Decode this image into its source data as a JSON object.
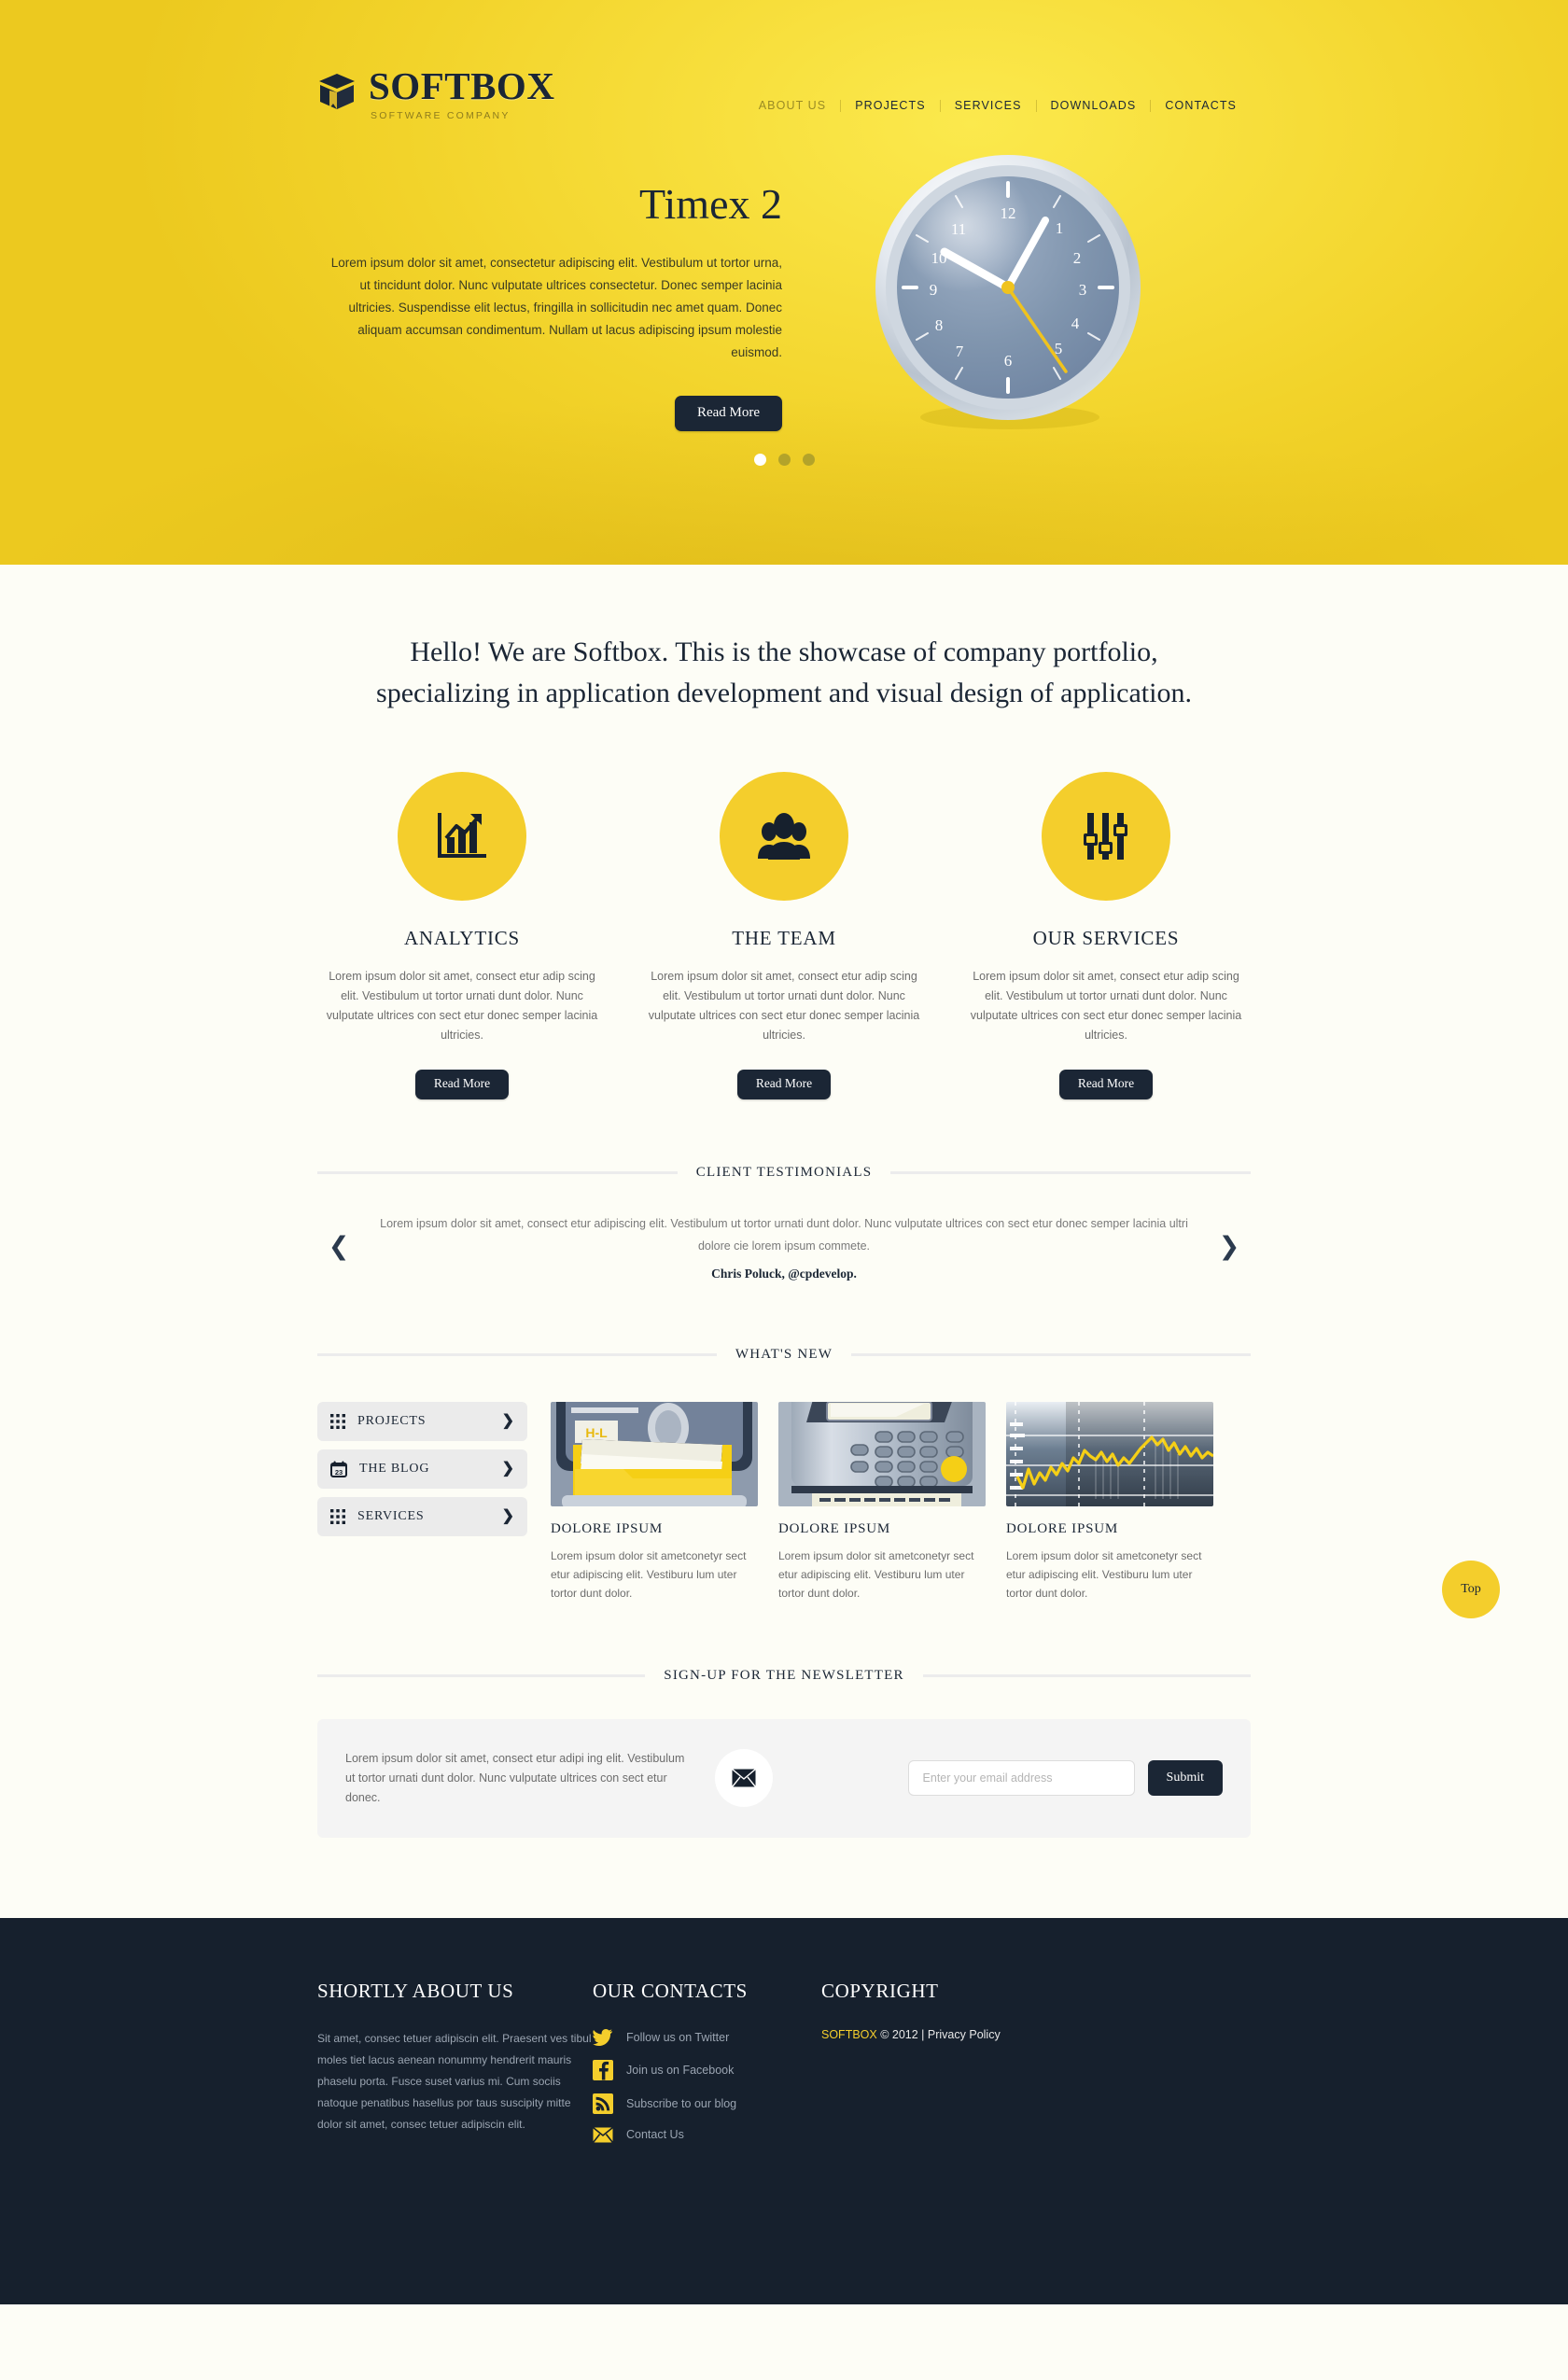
{
  "brand": {
    "name": "SOFTBOX",
    "tagline": "SOFTWARE COMPANY",
    "logo_icon": "open-box-icon",
    "accent_color": "#f4ce2c",
    "dark_color": "#1b2635"
  },
  "nav": {
    "items": [
      {
        "label": "ABOUT US",
        "muted": true
      },
      {
        "label": "PROJECTS",
        "muted": false
      },
      {
        "label": "SERVICES",
        "muted": false
      },
      {
        "label": "DOWNLOADS",
        "muted": false
      },
      {
        "label": "CONTACTS",
        "muted": false
      }
    ]
  },
  "hero": {
    "title": "Timex 2",
    "text": "Lorem ipsum dolor sit amet, consectetur adipiscing elit. Vestibulum ut tortor urna, ut tincidunt dolor. Nunc vulputate ultrices consectetur. Donec semper lacinia ultricies. Suspendisse elit lectus, fringilla in sollicitudin nec amet quam. Donec aliquam accumsan condimentum. Nullam ut lacus adipiscing ipsum molestie euismod.",
    "button_label": "Read More",
    "image_icon": "wall-clock-image",
    "slides": [
      {
        "active": true
      },
      {
        "active": false
      },
      {
        "active": false
      }
    ]
  },
  "intro": {
    "headline": "Hello! We are Softbox. This is the showcase of company portfolio, specializing in application development and visual design of application."
  },
  "features": [
    {
      "icon": "chart-growth-icon",
      "title": "ANALYTICS",
      "text": "Lorem ipsum dolor sit amet, consect etur adip scing elit. Vestibulum ut tortor urnati dunt dolor. Nunc vulputate ultrices con sect etur donec semper lacinia ultricies.",
      "button_label": "Read More"
    },
    {
      "icon": "people-group-icon",
      "title": "THE TEAM",
      "text": "Lorem ipsum dolor sit amet, consect etur adip scing elit. Vestibulum ut tortor urnati dunt dolor. Nunc vulputate ultrices con sect etur donec semper lacinia ultricies.",
      "button_label": "Read More"
    },
    {
      "icon": "sliders-equalizer-icon",
      "title": "OUR SERVICES",
      "text": "Lorem ipsum dolor sit amet, consect etur adip scing elit. Vestibulum ut tortor urnati dunt dolor. Nunc vulputate ultrices con sect etur donec semper lacinia ultricies.",
      "button_label": "Read More"
    }
  ],
  "testimonials": {
    "section_title": "CLIENT TESTIMONIALS",
    "prev_icon": "chevron-left-icon",
    "next_icon": "chevron-right-icon",
    "quote": "Lorem ipsum dolor sit amet, consect etur adipiscing elit. Vestibulum ut tortor urnati dunt dolor. Nunc vulputate ultrices con sect etur donec semper lacinia ultri  dolore cie lorem ipsum commete.",
    "author": "Chris Poluck, @cpdevelop."
  },
  "whats_new": {
    "section_title": "WHAT'S NEW",
    "tabs": [
      {
        "label": "PROJECTS",
        "icon": "grid-icon",
        "chevron": "chevron-right-icon"
      },
      {
        "label": "THE BLOG",
        "icon": "calendar-icon",
        "calendar_day": "23",
        "chevron": "chevron-right-icon"
      },
      {
        "label": "SERVICES",
        "icon": "grid-icon",
        "chevron": "chevron-right-icon"
      }
    ],
    "cards": [
      {
        "image_icon": "filing-cabinet-image",
        "folder_label": "H-L",
        "title": "DOLORE IPSUM",
        "text": "Lorem ipsum dolor sit ametconetyr sect etur adipiscing elit. Vestiburu lum uter tortor dunt dolor."
      },
      {
        "image_icon": "calculator-device-image",
        "title": "DOLORE IPSUM",
        "text": "Lorem ipsum dolor sit ametconetyr sect etur adipiscing elit. Vestiburu lum uter tortor dunt dolor."
      },
      {
        "image_icon": "stock-chart-image",
        "title": "DOLORE IPSUM",
        "text": "Lorem ipsum dolor sit ametconetyr sect etur adipiscing elit. Vestiburu lum uter tortor dunt dolor."
      }
    ]
  },
  "newsletter": {
    "section_title": "SIGN-UP FOR THE NEWSLETTER",
    "text": "Lorem ipsum dolor sit amet, consect etur adipi ing elit. Vestibulum ut tortor urnati dunt dolor. Nunc vulputate ultrices con sect etur donec.",
    "icon": "envelope-icon",
    "input_placeholder": "Enter your email address",
    "input_value": "",
    "submit_label": "Submit"
  },
  "top_button": {
    "label": "Top"
  },
  "footer": {
    "about": {
      "title": "SHORTLY ABOUT US",
      "text": "Sit amet, consec tetuer adipiscin elit. Praesent ves tibul moles tiet lacus aenean nonummy hendrerit mauris phaselu porta. Fusce suset varius mi. Cum sociis natoque penatibus hasellus por taus suscipity mitte dolor sit amet, consec tetuer adipiscin elit."
    },
    "contacts": {
      "title": "OUR CONTACTS",
      "items": [
        {
          "icon": "twitter-icon",
          "label": "Follow us on Twitter"
        },
        {
          "icon": "facebook-icon",
          "label": "Join us on Facebook"
        },
        {
          "icon": "rss-icon",
          "label": "Subscribe to our blog"
        },
        {
          "icon": "envelope-icon",
          "label": "Contact Us"
        }
      ]
    },
    "copyright": {
      "title": "COPYRIGHT",
      "brand": "SOFTBOX",
      "text": " © 2012 | ",
      "privacy_label": "Privacy Policy"
    }
  }
}
